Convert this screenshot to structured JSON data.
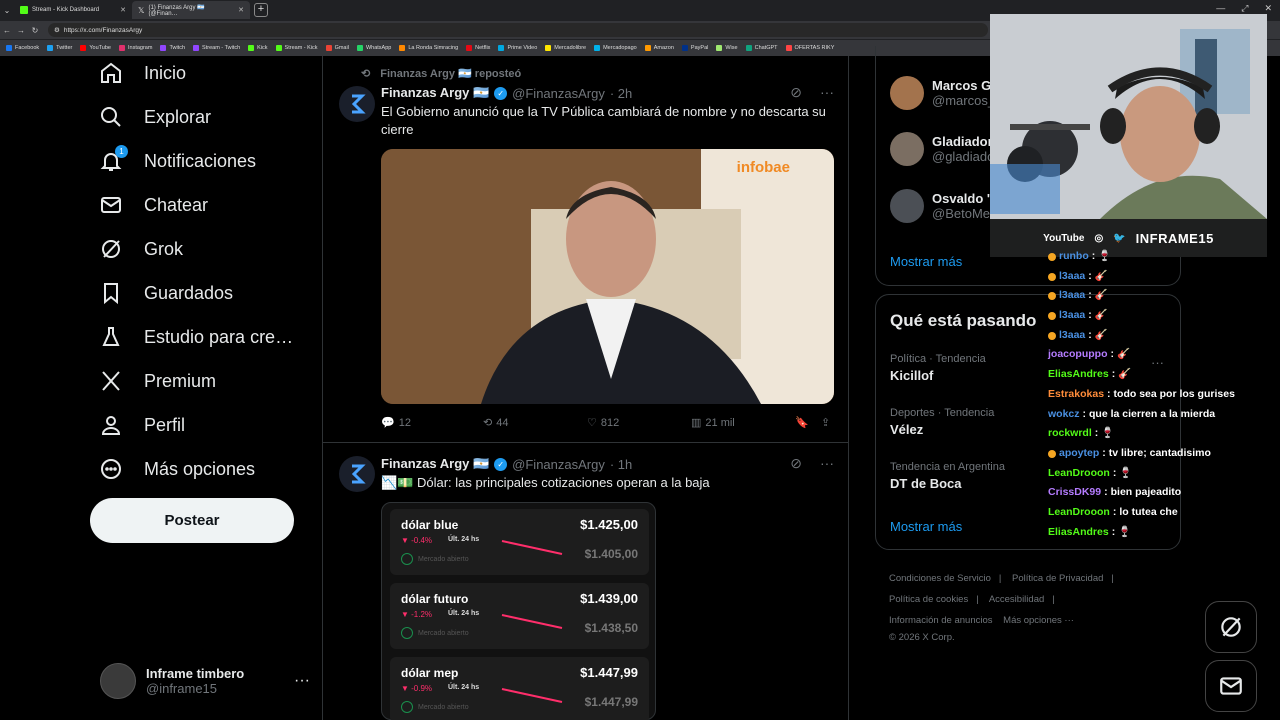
{
  "browser": {
    "tabs": [
      {
        "title": "Stream - Kick Dashboard",
        "fav_color": "#53fc18"
      },
      {
        "title": "(1) Finanzas Argy 🇦🇷 (@Finan…",
        "fav_color": "#ffffff"
      }
    ],
    "url": "https://x.com/FinanzasArgy",
    "bookmarks": [
      "Facebook",
      "Twitter",
      "YouTube",
      "Instagram",
      "Twitch",
      "Stream - Twitch",
      "Kick",
      "Stream - Kick",
      "Gmail",
      "WhatsApp",
      "La Ronda Simracing",
      "Netflix",
      "Prime Video",
      "Mercadolibre",
      "Mercadopago",
      "Amazon",
      "PayPal",
      "Wise",
      "ChatGPT",
      "OFERTAS RIKY"
    ]
  },
  "sidebar": {
    "items": [
      {
        "label": "Inicio",
        "icon": "home-icon"
      },
      {
        "label": "Explorar",
        "icon": "search-icon"
      },
      {
        "label": "Notificaciones",
        "icon": "bell-icon",
        "badge": "1"
      },
      {
        "label": "Chatear",
        "icon": "mail-icon"
      },
      {
        "label": "Grok",
        "icon": "grok-icon"
      },
      {
        "label": "Guardados",
        "icon": "bookmark-icon"
      },
      {
        "label": "Estudio para cre…",
        "icon": "flask-icon"
      },
      {
        "label": "Premium",
        "icon": "x-logo-icon"
      },
      {
        "label": "Perfil",
        "icon": "user-icon"
      },
      {
        "label": "Más opciones",
        "icon": "more-circle-icon"
      }
    ],
    "post_label": "Postear",
    "account": {
      "name": "Inframe timbero",
      "handle": "@inframe15",
      "more": "···"
    }
  },
  "feed": {
    "tweet1": {
      "repost_label": "Finanzas Argy 🇦🇷 reposteó",
      "name": "Finanzas Argy 🇦🇷",
      "handle": "@FinanzasArgy",
      "time": "· 2h",
      "text": "El Gobierno anunció que la TV Pública cambiará de nombre y no descarta su cierre",
      "media_watermark": "infobae",
      "replies": "12",
      "reposts": "44",
      "likes": "812",
      "views": "21 mil"
    },
    "tweet2": {
      "name": "Finanzas Argy 🇦🇷",
      "handle": "@FinanzasArgy",
      "time": "· 1h",
      "text": "📉💵 Dólar: las principales cotizaciones operan a la baja",
      "rates": [
        {
          "name": "dólar blue",
          "change": "▼ -0.4%",
          "last": "Últ. 24 hs",
          "price": "$1.425,00",
          "prev": "$1.405,00",
          "market": "Mercado abierto"
        },
        {
          "name": "dólar futuro",
          "change": "▼ -1.2%",
          "last": "Últ. 24 hs",
          "price": "$1.439,00",
          "prev": "$1.438,50",
          "market": "Mercado abierto"
        },
        {
          "name": "dólar mep",
          "change": "▼ -0.9%",
          "last": "Últ. 24 hs",
          "price": "$1.447,99",
          "prev": "$1.447,99",
          "market": "Mercado abierto"
        }
      ]
    }
  },
  "right": {
    "follow": [
      {
        "name": "Marcos G",
        "handle": "@marcos_"
      },
      {
        "name": "Gladiador",
        "handle": "@gladiado"
      },
      {
        "name": "Osvaldo '",
        "handle": "@BetoMe"
      }
    ],
    "show_more": "Mostrar más",
    "trends_title": "Qué está pasando",
    "trends": [
      {
        "meta": "Política · Tendencia",
        "name": "Kicillof"
      },
      {
        "meta": "Deportes · Tendencia",
        "name": "Vélez"
      },
      {
        "meta": "Tendencia en Argentina",
        "name": "DT de Boca"
      }
    ],
    "trends_more": "Mostrar más",
    "footer": [
      "Condiciones de Servicio",
      "|",
      "Política de Privacidad",
      "|",
      "Política de cookies",
      "|",
      "Accesibilidad",
      "|",
      "Información de anuncios",
      "Más opciones ···",
      "© 2026 X Corp."
    ]
  },
  "stream": {
    "overlay": {
      "youtube": "YouTube",
      "brand": "INFRAME15"
    },
    "chat": [
      {
        "user": "runbo",
        "msg": "🍷",
        "color": "#4a90e2",
        "badge": true
      },
      {
        "user": "l3aaa",
        "msg": "🎸",
        "color": "#4a90e2",
        "badge": true
      },
      {
        "user": "l3aaa",
        "msg": "🎸",
        "color": "#4a90e2",
        "badge": true
      },
      {
        "user": "l3aaa",
        "msg": "🎸",
        "color": "#4a90e2",
        "badge": true
      },
      {
        "user": "l3aaa",
        "msg": "🎸",
        "color": "#4a90e2",
        "badge": true
      },
      {
        "user": "joacopuppo",
        "msg": "🎸",
        "color": "#b57cff",
        "badge": false
      },
      {
        "user": "EliasAndres",
        "msg": "🎸",
        "color": "#53fc18",
        "badge": false
      },
      {
        "user": "Estrakokas",
        "msg": "todo sea por los gurises",
        "color": "#ff8c3a",
        "badge": false
      },
      {
        "user": "wokcz",
        "msg": "que la cierren a la mierda",
        "color": "#4a90e2",
        "badge": false
      },
      {
        "user": "rockwrdl",
        "msg": "🍷",
        "color": "#53fc18",
        "badge": false
      },
      {
        "user": "apoytep",
        "msg": "tv libre; cantadisimo",
        "color": "#4a90e2",
        "badge": true
      },
      {
        "user": "LeanDrooon",
        "msg": "🍷",
        "color": "#53fc18",
        "badge": false
      },
      {
        "user": "CrissDK99",
        "msg": "bien pajeadito",
        "color": "#b57cff",
        "badge": false
      },
      {
        "user": "LeanDrooon",
        "msg": "lo tutea che",
        "color": "#53fc18",
        "badge": false
      },
      {
        "user": "EliasAndres",
        "msg": "🍷",
        "color": "#53fc18",
        "badge": false
      }
    ]
  },
  "colors": {
    "accent": "#1d9bf0",
    "down": "#ff2e6b",
    "bg": "#000000"
  }
}
